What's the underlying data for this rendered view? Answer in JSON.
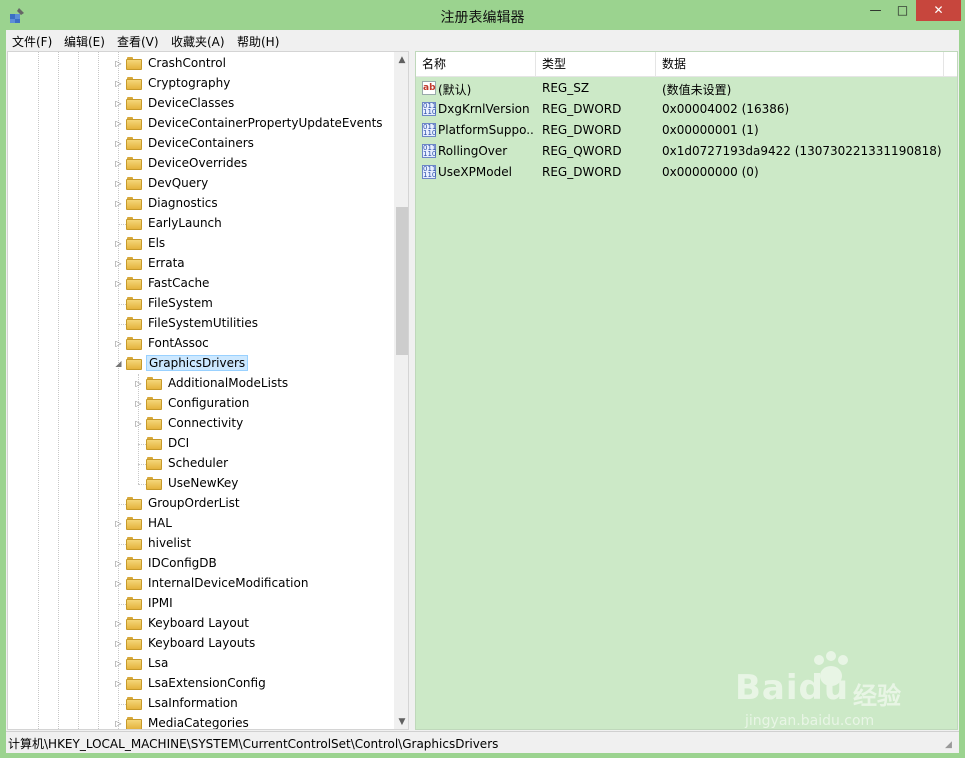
{
  "window": {
    "title": "注册表编辑器",
    "min_glyph": "—",
    "max_glyph": "□",
    "close_glyph": "✕"
  },
  "menu": [
    "文件(F)",
    "编辑(E)",
    "查看(V)",
    "收藏夹(A)",
    "帮助(H)"
  ],
  "tree": {
    "items": [
      {
        "label": "CrashControl",
        "depth": 0,
        "expandable": true
      },
      {
        "label": "Cryptography",
        "depth": 0,
        "expandable": true
      },
      {
        "label": "DeviceClasses",
        "depth": 0,
        "expandable": true
      },
      {
        "label": "DeviceContainerPropertyUpdateEvents",
        "depth": 0,
        "expandable": true
      },
      {
        "label": "DeviceContainers",
        "depth": 0,
        "expandable": true
      },
      {
        "label": "DeviceOverrides",
        "depth": 0,
        "expandable": true
      },
      {
        "label": "DevQuery",
        "depth": 0,
        "expandable": true
      },
      {
        "label": "Diagnostics",
        "depth": 0,
        "expandable": true
      },
      {
        "label": "EarlyLaunch",
        "depth": 0,
        "expandable": false
      },
      {
        "label": "Els",
        "depth": 0,
        "expandable": true
      },
      {
        "label": "Errata",
        "depth": 0,
        "expandable": true
      },
      {
        "label": "FastCache",
        "depth": 0,
        "expandable": true
      },
      {
        "label": "FileSystem",
        "depth": 0,
        "expandable": false
      },
      {
        "label": "FileSystemUtilities",
        "depth": 0,
        "expandable": false
      },
      {
        "label": "FontAssoc",
        "depth": 0,
        "expandable": true
      },
      {
        "label": "GraphicsDrivers",
        "depth": 0,
        "expandable": true,
        "expanded": true,
        "selected": true
      },
      {
        "label": "AdditionalModeLists",
        "depth": 1,
        "expandable": true
      },
      {
        "label": "Configuration",
        "depth": 1,
        "expandable": true
      },
      {
        "label": "Connectivity",
        "depth": 1,
        "expandable": true
      },
      {
        "label": "DCI",
        "depth": 1,
        "expandable": false
      },
      {
        "label": "Scheduler",
        "depth": 1,
        "expandable": false
      },
      {
        "label": "UseNewKey",
        "depth": 1,
        "expandable": false
      },
      {
        "label": "GroupOrderList",
        "depth": 0,
        "expandable": false
      },
      {
        "label": "HAL",
        "depth": 0,
        "expandable": true
      },
      {
        "label": "hivelist",
        "depth": 0,
        "expandable": false
      },
      {
        "label": "IDConfigDB",
        "depth": 0,
        "expandable": true
      },
      {
        "label": "InternalDeviceModification",
        "depth": 0,
        "expandable": true
      },
      {
        "label": "IPMI",
        "depth": 0,
        "expandable": false
      },
      {
        "label": "Keyboard Layout",
        "depth": 0,
        "expandable": true
      },
      {
        "label": "Keyboard Layouts",
        "depth": 0,
        "expandable": true
      },
      {
        "label": "Lsa",
        "depth": 0,
        "expandable": true
      },
      {
        "label": "LsaExtensionConfig",
        "depth": 0,
        "expandable": true
      },
      {
        "label": "LsaInformation",
        "depth": 0,
        "expandable": false
      },
      {
        "label": "MediaCategories",
        "depth": 0,
        "expandable": true
      }
    ]
  },
  "list": {
    "columns": [
      "名称",
      "类型",
      "数据"
    ],
    "rows": [
      {
        "icon": "string-value-icon",
        "name": "(默认)",
        "type": "REG_SZ",
        "data": "(数值未设置)"
      },
      {
        "icon": "binary-value-icon",
        "name": "DxgKrnlVersion",
        "type": "REG_DWORD",
        "data": "0x00004002 (16386)"
      },
      {
        "icon": "binary-value-icon",
        "name": "PlatformSuppo...",
        "type": "REG_DWORD",
        "data": "0x00000001 (1)"
      },
      {
        "icon": "binary-value-icon",
        "name": "RollingOver",
        "type": "REG_QWORD",
        "data": "0x1d0727193da9422 (130730221331190818)"
      },
      {
        "icon": "binary-value-icon",
        "name": "UseXPModel",
        "type": "REG_DWORD",
        "data": "0x00000000 (0)"
      }
    ]
  },
  "statusbar": {
    "path": "计算机\\HKEY_LOCAL_MACHINE\\SYSTEM\\CurrentControlSet\\Control\\GraphicsDrivers"
  },
  "watermark": {
    "brand": "Bai",
    "brand_suffix": "du",
    "cn": "经验",
    "url": "jingyan.baidu.com"
  },
  "colors": {
    "frame": "#9bd38f",
    "list_bg": "#cce9c7",
    "selection": "#cce8ff",
    "close": "#c7463d"
  }
}
